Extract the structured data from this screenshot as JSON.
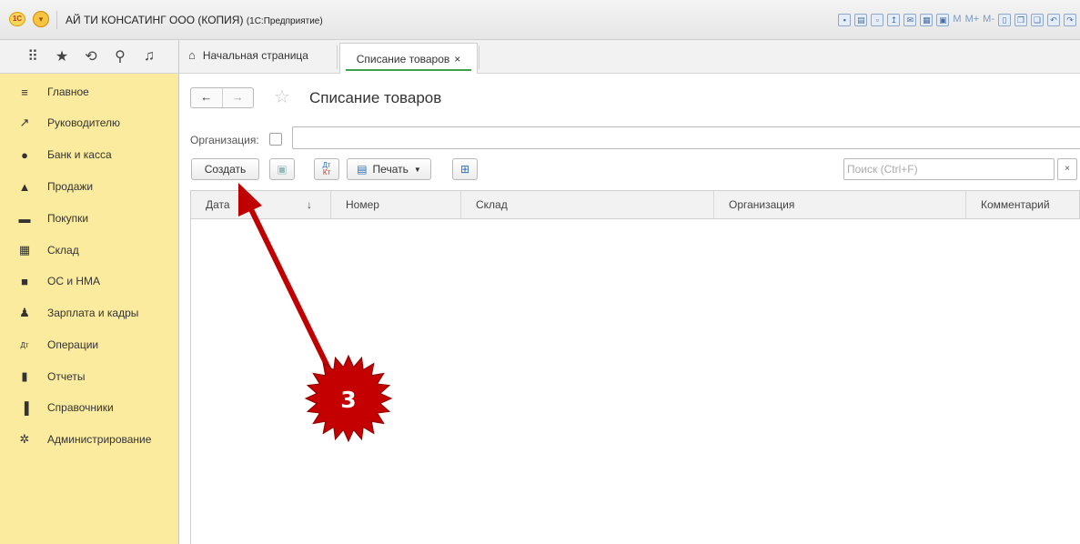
{
  "window": {
    "logo_text": "1С",
    "title": "АЙ ТИ КОНСАТИНГ ООО (КОПИЯ)",
    "app_name": "(1С:Предприятие)",
    "toolbar_memory": [
      "M",
      "M+",
      "M-"
    ]
  },
  "sidebar": {
    "items": [
      {
        "icon": "menu-icon",
        "label": "Главное"
      },
      {
        "icon": "chart-trend-icon",
        "label": "Руководителю"
      },
      {
        "icon": "ruble-icon",
        "label": "Банк и касса"
      },
      {
        "icon": "bag-icon",
        "label": "Продажи"
      },
      {
        "icon": "cart-icon",
        "label": "Покупки"
      },
      {
        "icon": "warehouse-icon",
        "label": "Склад"
      },
      {
        "icon": "truck-icon",
        "label": "ОС и НМА"
      },
      {
        "icon": "person-icon",
        "label": "Зарплата и кадры"
      },
      {
        "icon": "dt-kt-icon",
        "label": "Операции"
      },
      {
        "icon": "bar-chart-icon",
        "label": "Отчеты"
      },
      {
        "icon": "books-icon",
        "label": "Справочники"
      },
      {
        "icon": "gear-icon",
        "label": "Администрирование"
      }
    ]
  },
  "tabs": {
    "home": "Начальная страница",
    "active": "Списание товаров",
    "close": "×"
  },
  "page": {
    "title": "Списание товаров",
    "org_label": "Организация:",
    "org_value": "",
    "create_button": "Создать",
    "print_button": "Печать",
    "dtkt_top": "Дт",
    "dtkt_bottom": "Кт",
    "search_placeholder": "Поиск (Ctrl+F)",
    "search_clear": "×"
  },
  "table": {
    "columns": [
      "Дата",
      "Номер",
      "Склад",
      "Организация",
      "Комментарий"
    ],
    "sort_indicator": "↓",
    "rows": []
  },
  "annotation": {
    "step_number": "3",
    "badge_color": "#c40000",
    "arrow_color": "#c00000",
    "target": "create-button"
  },
  "colors": {
    "sidebar_bg": "#fbeb9e",
    "active_tab_underline": "#3da14a"
  }
}
